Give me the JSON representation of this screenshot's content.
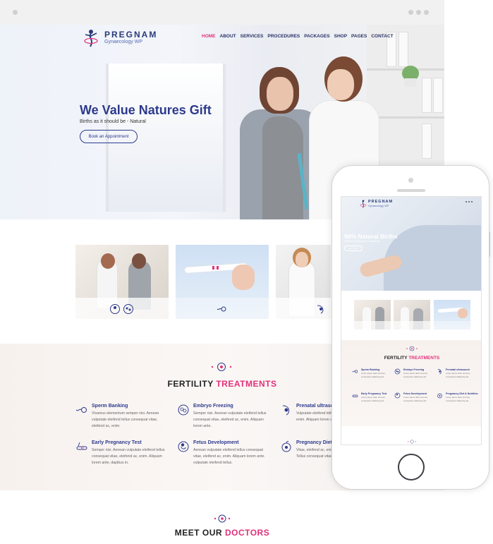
{
  "brand": {
    "name": "PREGNAM",
    "tagline": "Gynaecology WP",
    "colors": {
      "primary": "#2c3a8c",
      "accent": "#e3307a"
    }
  },
  "nav": [
    {
      "label": "HOME",
      "active": true
    },
    {
      "label": "ABOUT"
    },
    {
      "label": "SERVICES"
    },
    {
      "label": "PROCEDURES"
    },
    {
      "label": "PACKAGES"
    },
    {
      "label": "SHOP"
    },
    {
      "label": "PAGES"
    },
    {
      "label": "CONTACT"
    }
  ],
  "hero": {
    "title": "We Value Natures Gift",
    "subtitle": "Births as it should be - Natural",
    "button": "Book an Appointment"
  },
  "fertility": {
    "title_plain": "FERTILITY",
    "title_accent": "TREATMENTS",
    "services": [
      {
        "icon": "sperm-icon",
        "title": "Sperm Banking",
        "text": "Vivamus elementum semper nisi. Aenean vulputate eleifend tellus consequat vitae, eleifend ac, enim."
      },
      {
        "icon": "embryo-icon",
        "title": "Embryo Freezing",
        "text": "Semper nisi. Aenean vulputate eleifend tellus consequat vitae, eleifend ac, enim. Aliquam lorem ante."
      },
      {
        "icon": "ultrasound-icon",
        "title": "Prenatal ultrasou",
        "text": "Vulputate eleifend tellus vitae, eleifend ac, enim. Aliquam lorem ante, dapibus in."
      },
      {
        "icon": "pregnancy-test-icon",
        "title": "Early Pregnancy Test",
        "text": "Semper nisi. Aenean vulputate eleifend tellus consequat vitae, eleifend ac, enim. Aliquam lorem ante, dapibus in."
      },
      {
        "icon": "fetus-icon",
        "title": "Fetus Development",
        "text": "Aenean vulputate eleifend tellus consequat vitae, eleifend ac, enim. Aliquam lorem ante. vulputate eleifend tellus."
      },
      {
        "icon": "nutrition-icon",
        "title": "Pregnancy Diet &",
        "text": "Vitae, eleifend ac, enim. Aliquam lorem ante. Tellus consequat vitae."
      }
    ]
  },
  "doctors": {
    "title_plain": "MEET OUR",
    "title_accent": "DOCTORS"
  },
  "mobile": {
    "hero_title": "90% Natural Births",
    "hero_sub": "Painless Pregnancy Treatments",
    "hero_button": "View More",
    "fertility_title_plain": "FERTILITY",
    "fertility_title_accent": "TREATMENTS",
    "services": [
      {
        "title": "Sperm Banking",
        "text": "Lorem ipsum dolor sit amet, consectetur adipiscing elit."
      },
      {
        "title": "Embryo Freezing",
        "text": "Lorem ipsum dolor sit amet, consectetur adipiscing elit."
      },
      {
        "title": "Prenatal ultrasound",
        "text": "Lorem ipsum dolor sit amet, consectetur adipiscing elit."
      },
      {
        "title": "Early Pregnancy Test",
        "text": "Lorem ipsum dolor sit amet, consectetur adipiscing elit."
      },
      {
        "title": "Fetus Development",
        "text": "Lorem ipsum dolor sit amet, consectetur adipiscing elit."
      },
      {
        "title": "Pregnancy Diet & Nutrition",
        "text": "Lorem ipsum dolor sit amet, consectetur adipiscing elit."
      }
    ]
  }
}
